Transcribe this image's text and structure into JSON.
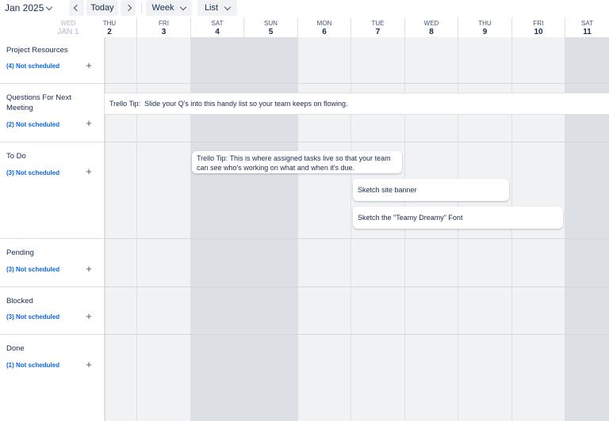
{
  "toolbar": {
    "month_label": "Jan 2025",
    "today_label": "Today",
    "view_label": "Week",
    "layout_label": "List"
  },
  "days": [
    {
      "name": "WED",
      "date": "JAN 1"
    },
    {
      "name": "THU",
      "date": "2"
    },
    {
      "name": "FRI",
      "date": "3"
    },
    {
      "name": "SAT",
      "date": "4"
    },
    {
      "name": "SUN",
      "date": "5"
    },
    {
      "name": "MON",
      "date": "6"
    },
    {
      "name": "TUE",
      "date": "7"
    },
    {
      "name": "WED",
      "date": "8"
    },
    {
      "name": "THU",
      "date": "9"
    },
    {
      "name": "FRI",
      "date": "10"
    },
    {
      "name": "SAT",
      "date": "11"
    }
  ],
  "rows": [
    {
      "title": "Project Resources",
      "sub": "(4) Not scheduled"
    },
    {
      "title": "Questions For Next Meeting",
      "sub": "(2) Not scheduled"
    },
    {
      "title": "To Do",
      "sub": "(3) Not scheduled"
    },
    {
      "title": "Pending",
      "sub": "(3) Not scheduled"
    },
    {
      "title": "Blocked",
      "sub": "(3) Not scheduled"
    },
    {
      "title": "Done",
      "sub": "(1) Not scheduled"
    }
  ],
  "cards": {
    "tip_questions": "Trello Tip:  Slide your Q's into this handy list so your team keeps on flowing.",
    "tip_todo": "Trello Tip: This is where assigned tasks live so that your team can see who's working on what and when it's due.",
    "sketch_banner": "Sketch site banner",
    "sketch_font": "Sketch the \"Teamy Dreamy\" Font"
  },
  "icons": {
    "add": "+",
    "chevron": "chevron-down-icon"
  }
}
